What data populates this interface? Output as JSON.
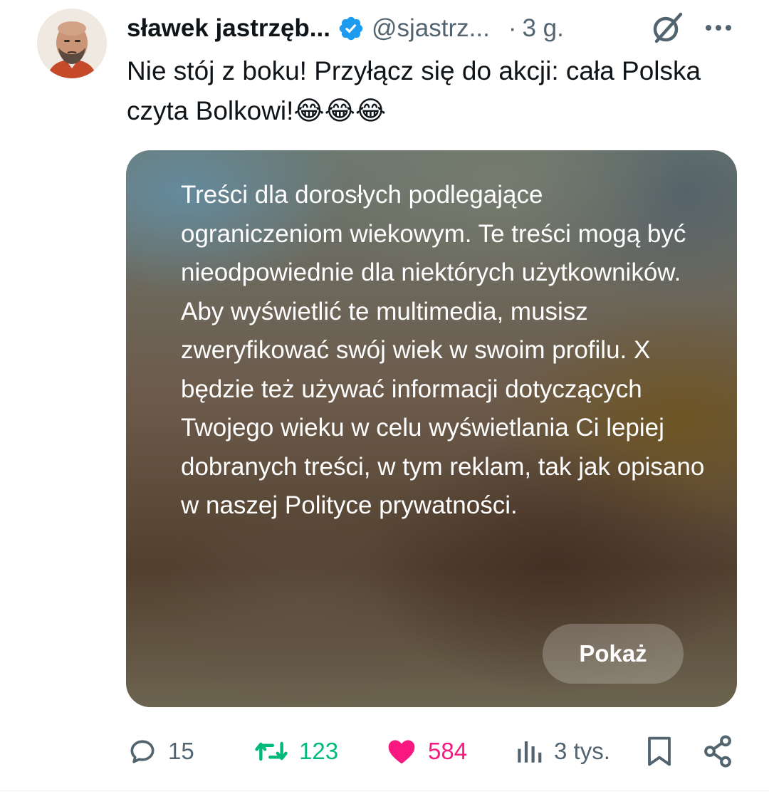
{
  "author": {
    "name": "sławek jastrzęb...",
    "handle": "@sjastrz...",
    "verified": true,
    "verified_color": "#1d9bf0"
  },
  "meta": {
    "separator": "·",
    "time": "3 g."
  },
  "tweet_text": "Nie stój z boku! Przyłącz się do akcji: cała Polska czyta Bolkowi!😂😂😂",
  "media_warning": {
    "message": "Treści dla dorosłych podlegające ograniczeniom wiekowym. Te treści mogą być nieodpowiednie dla niektórych użytkowników. Aby wyświetlić te multimedia, musisz zweryfikować swój wiek w swoim profilu. X będzie też używać informacji dotyczących Twojego wieku w celu wyświetlania Ci lepiej dobranych treści, w tym reklam, tak jak opisano w naszej Polityce prywatności.",
    "show_button": "Pokaż"
  },
  "actions": {
    "replies": "15",
    "reposts": "123",
    "likes": "584",
    "views": "3 tys."
  },
  "icons": {
    "verified": "verified-badge-icon",
    "grok": "grok-icon",
    "more": "more-icon",
    "reply": "reply-icon",
    "repost": "repost-icon",
    "like": "heart-icon",
    "views": "views-icon",
    "bookmark": "bookmark-icon",
    "share": "share-icon"
  },
  "colors": {
    "text": "#0f1419",
    "secondary": "#536471",
    "repost_active": "#00ba7c",
    "like_active": "#f91880"
  }
}
